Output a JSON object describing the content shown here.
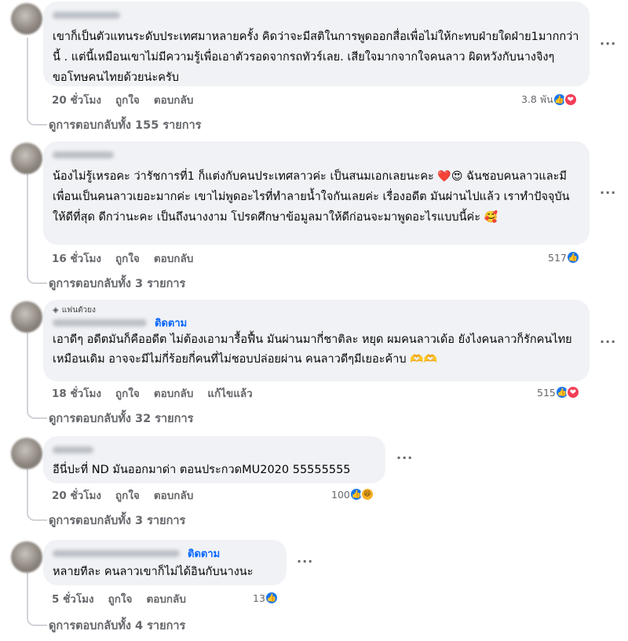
{
  "comments": [
    {
      "text": "เขาก็เป็นตัวแทนระดับประเทศมาหลายครั้ง คิดว่าจะมีสติในการพูดออกสื่อเพื่อไม่ให้กะทบฝ่ายใดฝ่าย1มากกว่านี้ . แต่นี้เหมือนเขาไม่มีความรู้เพื่อเอาตัวรอดจากรถทัวร์เลย. เสียใจมากจากใจคนลาว ผิดหวังกับนางจิงๆ ขอโทษคนไทยด้วยน่ะครับ",
      "time": "20 ชั่วโมง",
      "like": "ถูกใจ",
      "reply": "ตอบกลับ",
      "reaction_count": "3.8 พัน",
      "reactions": [
        "like-icon",
        "love-icon"
      ],
      "view_replies": "ดูการตอบกลับทั้ง 155 รายการ"
    },
    {
      "text": "น้องไม่รู้เหรอคะ ว่ารัชการที่1 ก็แต่งกับคนประเทศลาวค่ะ เป็นสนมเอกเลยนะคะ",
      "text2": "ฉันชอบคนลาวและมีเพื่อนเป็นคนลาวเยอะมากค่ะ เขาไม่พูดอะไรที่ทำลายน้ำใจกันเลยค่ะ เรื่องอดีต มันผ่านไปแล้ว เราทำปัจจุบันให้ดีที่สุด ดีกว่านะคะ เป็นถึงนางงาม โปรดศึกษาข้อมูลมาให้ดีก่อนจะมาพูดอะไรแบบนี้ค่ะ",
      "emoji_heart": "❤️😍",
      "emoji_end": "🥰",
      "time": "16 ชั่วโมง",
      "like": "ถูกใจ",
      "reply": "ตอบกลับ",
      "reaction_count": "517",
      "reactions": [
        "like-icon"
      ],
      "view_replies": "ดูการตอบกลับทั้ง 3 รายการ"
    },
    {
      "badge": "แฟนตัวยง",
      "follow": "ติดตาม",
      "text": "เอาดีๆ อดีตมันก็คืออดีต ไม่ต้องเอามารื้อฟื้น มันผ่านมากี่ชาติละ หยุด ผมคนลาวเด้อ ยังไงคนลาวก็รักคนไทยเหมือนเดิม อาจจะมีไม่กี่ร้อยกี่คนที่ไม่ชอบปล่อยผ่าน คนลาวดีๆมีเยอะค้าบ",
      "emoji_end": "🫶🫶",
      "time": "18 ชั่วโมง",
      "like": "ถูกใจ",
      "reply": "ตอบกลับ",
      "edited": "แก้ไขแล้ว",
      "reaction_count": "515",
      "reactions": [
        "like-icon",
        "love-icon"
      ],
      "view_replies": "ดูการตอบกลับทั้ง 32 รายการ"
    },
    {
      "text": "อีนี่ปะที่ ND มันออกมาด่า ตอนประกวดMU2020 55555555",
      "time": "20 ชั่วโมง",
      "like": "ถูกใจ",
      "reply": "ตอบกลับ",
      "reaction_count": "100",
      "reactions": [
        "like-icon",
        "haha-icon"
      ],
      "view_replies": "ดูการตอบกลับทั้ง 3 รายการ"
    },
    {
      "follow": "ติดตาม",
      "text": "หลายทีละ คนลาวเขาก็ไม่ได้อินกับนางนะ",
      "time": "5 ชั่วโมง",
      "like": "ถูกใจ",
      "reply": "ตอบกลับ",
      "reaction_count": "13",
      "reactions": [
        "like-icon"
      ],
      "view_replies": "ดูการตอบกลับทั้ง 4 รายการ"
    }
  ],
  "more_label": "···",
  "colors": {
    "link": "#0866ff",
    "muted": "#65676b",
    "bubble": "#f0f2f5",
    "like": "#1877f2",
    "love": "#f33e58"
  }
}
